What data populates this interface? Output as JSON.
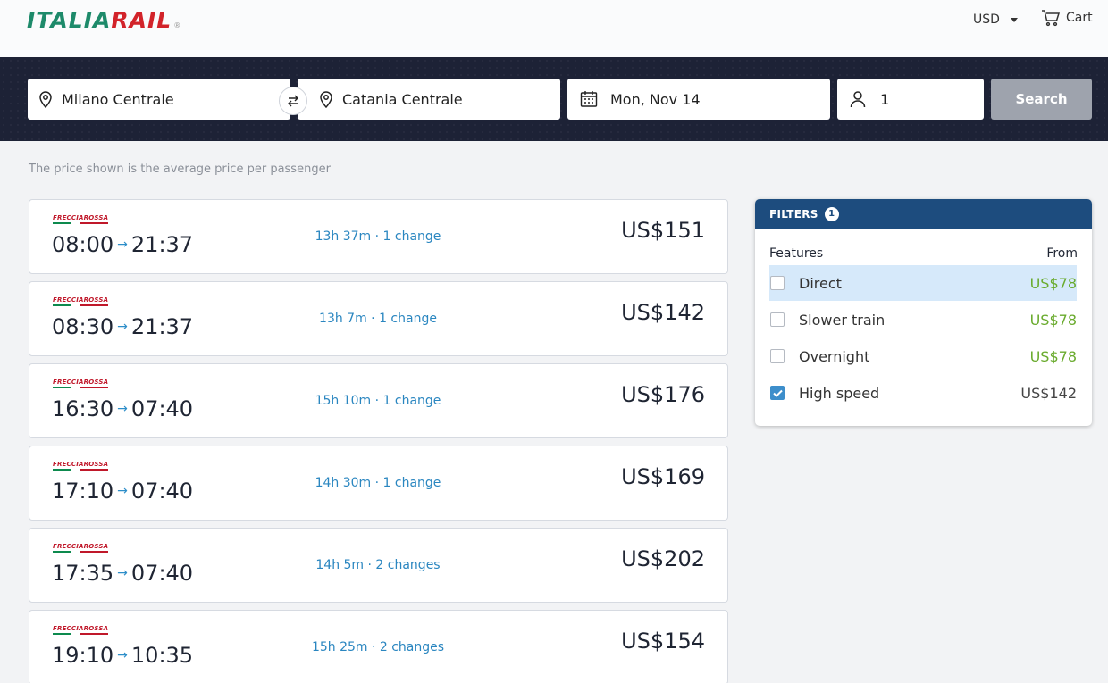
{
  "header": {
    "logo_part1": "ITALIA",
    "logo_part2": "RAIL",
    "logo_mark": "®",
    "currency": "USD",
    "cart_label": "Cart"
  },
  "search": {
    "from": "Milano Centrale",
    "to": "Catania Centrale",
    "date": "Mon, Nov 14",
    "passengers": "1",
    "button": "Search"
  },
  "note": "The price shown is the average price per passenger",
  "results": [
    {
      "brand": "FRECCIAROSSA",
      "depart": "08:00",
      "arrive": "21:37",
      "duration": "13h 37m · 1 change",
      "price": "US$151"
    },
    {
      "brand": "FRECCIAROSSA",
      "depart": "08:30",
      "arrive": "21:37",
      "duration": "13h 7m · 1 change",
      "price": "US$142"
    },
    {
      "brand": "FRECCIAROSSA",
      "depart": "16:30",
      "arrive": "07:40",
      "duration": "15h 10m · 1 change",
      "price": "US$176"
    },
    {
      "brand": "FRECCIAROSSA",
      "depart": "17:10",
      "arrive": "07:40",
      "duration": "14h 30m · 1 change",
      "price": "US$169"
    },
    {
      "brand": "FRECCIAROSSA",
      "depart": "17:35",
      "arrive": "07:40",
      "duration": "14h 5m · 2 changes",
      "price": "US$202"
    },
    {
      "brand": "FRECCIAROSSA",
      "depart": "19:10",
      "arrive": "10:35",
      "duration": "15h 25m · 2 changes",
      "price": "US$154"
    }
  ],
  "filters": {
    "title": "FILTERS",
    "count": "1",
    "col_features": "Features",
    "col_from": "From",
    "items": [
      {
        "label": "Direct",
        "price": "US$78",
        "checked": false,
        "highlighted": true
      },
      {
        "label": "Slower train",
        "price": "US$78",
        "checked": false
      },
      {
        "label": "Overnight",
        "price": "US$78",
        "checked": false
      },
      {
        "label": "High speed",
        "price": "US$142",
        "checked": true
      }
    ]
  },
  "colors": {
    "band": "#1d2236",
    "accent_blue": "#2a86c0",
    "filter_header": "#1d4c7e",
    "price_green": "#6aab2e",
    "logo_green": "#1d8a6a",
    "logo_red": "#d2232a"
  }
}
